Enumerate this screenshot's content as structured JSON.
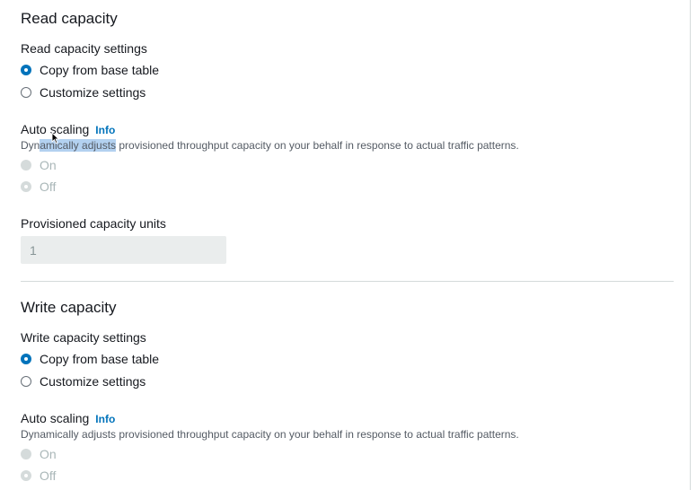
{
  "read": {
    "title": "Read capacity",
    "settings_label": "Read capacity settings",
    "options": [
      {
        "label": "Copy from base table",
        "checked": true
      },
      {
        "label": "Customize settings",
        "checked": false
      }
    ],
    "autoscaling_label": "Auto scaling",
    "info_link": "Info",
    "desc_pre": "Dyn",
    "desc_selected": "amically adjusts",
    "desc_post": " provisioned throughput capacity on your behalf in response to actual traffic patterns.",
    "autoscaling_options": [
      {
        "label": "On",
        "checked": false,
        "disabled": true
      },
      {
        "label": "Off",
        "checked": true,
        "disabled": true
      }
    ],
    "units_label": "Provisioned capacity units",
    "units_value": "1"
  },
  "write": {
    "title": "Write capacity",
    "settings_label": "Write capacity settings",
    "options": [
      {
        "label": "Copy from base table",
        "checked": true
      },
      {
        "label": "Customize settings",
        "checked": false
      }
    ],
    "autoscaling_label": "Auto scaling",
    "info_link": "Info",
    "description": "Dynamically adjusts provisioned throughput capacity on your behalf in response to actual traffic patterns.",
    "autoscaling_options": [
      {
        "label": "On",
        "checked": false,
        "disabled": true
      },
      {
        "label": "Off",
        "checked": true,
        "disabled": true
      }
    ]
  },
  "colors": {
    "accent": "#0073bb",
    "text": "#16191f",
    "disabled": "#aab7b8",
    "selection": "#b3d1f0"
  },
  "icons": {
    "cursor": "mouse-pointer-icon"
  }
}
